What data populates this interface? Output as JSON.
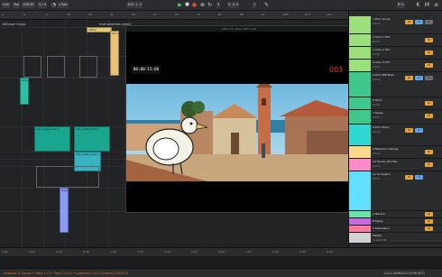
{
  "toolbar": {
    "link_label": "Link",
    "tap_label": "Tap",
    "tempo": "108.00",
    "time_signature": "4 / 4",
    "quantize": "1 Bar",
    "position": "100. 1. 1",
    "tempo_mode": "3",
    "time_readout": "0. 0. 0",
    "zoom": "1",
    "cpu": "8 %"
  },
  "ruler": {
    "ticks": [
      "1",
      "9",
      "17",
      "25",
      "33",
      "41",
      "49",
      "57",
      "65",
      "73",
      "81",
      "89",
      "97",
      "105",
      "113",
      "121"
    ]
  },
  "tracks": {
    "clips": [
      {
        "label": "108 Ir",
        "color": "#e3c77a"
      },
      {
        "label": "Cls chord",
        "color": "#e9c27a"
      },
      {
        "label": "Clip (dual)",
        "color": "#2fbfa5"
      },
      {
        "label": "Clip (dual) marry",
        "color": "#1aa68e"
      },
      {
        "label": "Clip (dual) marry",
        "color": "#1aa68e"
      },
      {
        "label": "Clip (dual) marry",
        "color": "#3ab3c0"
      },
      {
        "label": "Harp",
        "color": "#8a9cf5"
      }
    ],
    "header_label": "108 bpm Group",
    "arrange_header_2": "Instruments",
    "arrange_header_3": "ds select"
  },
  "video": {
    "title": "ADCC Ch Video Intro mp4",
    "timecode": "00:00:15:06",
    "frame": "003"
  },
  "mixer": {
    "tracks": [
      {
        "name": "1 DCC Group",
        "sub": "All Ins",
        "color": "#9be07a"
      },
      {
        "name": "2 Intro 1 SFX",
        "sub": "All Ch",
        "color": "#9be07a"
      },
      {
        "name": "3 Intro 2 SFX",
        "sub": "All Ch",
        "color": "#9be07a"
      },
      {
        "name": "4 Intro 3 SFX",
        "sub": "All Ch",
        "color": "#9be07a"
      },
      {
        "name": "5 DCC 808 Bass",
        "sub": "All Ins",
        "color": "#40c88c"
      },
      {
        "name": "6 Hard",
        "sub": "All Ch",
        "color": "#40c88c"
      },
      {
        "name": "7 Delay",
        "sub": "All Ch",
        "color": "#40c88c"
      },
      {
        "name": "8 DCC Piano",
        "sub": "All Ins",
        "color": "#2fd8d0"
      },
      {
        "name": "9 Mellotron Strings",
        "sub": "All Ins",
        "color": "#ffd98a"
      },
      {
        "name": "10 Fender Rhodes",
        "sub": "All Ins",
        "color": "#ff8ac8"
      },
      {
        "name": "11 Orchestra",
        "sub": "All Ins",
        "color": "#60dfff"
      },
      {
        "name": "A Reverb",
        "sub": "",
        "color": "#6be3a8"
      },
      {
        "name": "B Delay",
        "sub": "",
        "color": "#c86be3"
      },
      {
        "name": "C Saturation",
        "sub": "",
        "color": "#ff7a9e"
      },
      {
        "name": "Master",
        "sub": "",
        "color": "#d2d2d2"
      }
    ],
    "monitor_label": "In Auto Off",
    "send_label": "S",
    "arm_label": "M",
    "solo_label": "S"
  },
  "bottom": {
    "ruler_ticks": [
      "0:00",
      "0:15",
      "0:30",
      "0:45",
      "1:00",
      "1:15",
      "1:30",
      "1:45",
      "2:00",
      "2:15",
      "2:30",
      "2:45",
      "3:00"
    ]
  },
  "status": {
    "left_text": "Inspector & Groups • Video 1.0.1 • Post 111.4.2 • Loopnixer 0.0.4.3 [Demo] 3/30/2021",
    "right_text": "1-DCC ANIMATICCH-PROJECT"
  },
  "colors": {
    "accent_orange": "#e17a2d",
    "play_green": "#4ad06a",
    "record_red": "#e04a3a",
    "frame_red": "#e9443a"
  }
}
